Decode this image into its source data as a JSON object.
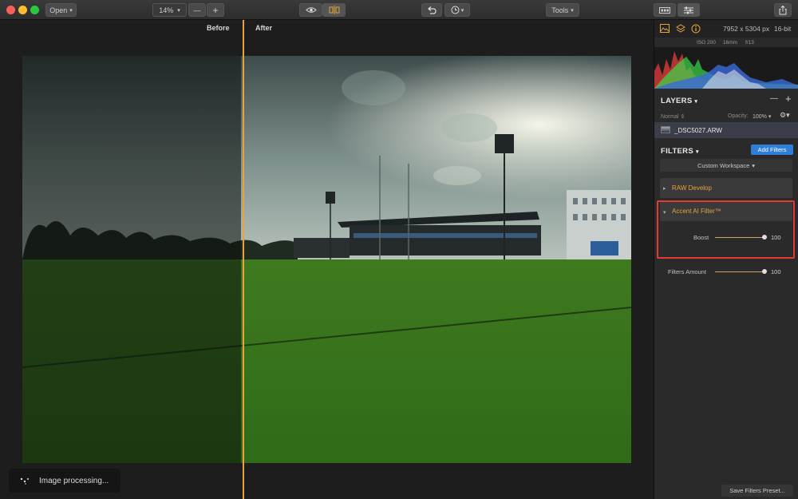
{
  "toolbar": {
    "open_label": "Open",
    "zoom_value": "14%",
    "zoom_minus": "—",
    "zoom_plus": "+",
    "tools_label": "Tools"
  },
  "canvas": {
    "before_label": "Before",
    "after_label": "After",
    "split_position": 0.363
  },
  "toast": {
    "text": "Image processing..."
  },
  "panel": {
    "dimensions": "7952 x 5304 px",
    "bit_depth": "16-bit",
    "exif": {
      "iso": "ISO 200",
      "focal": "16mm",
      "aperture": "f/13"
    },
    "layers": {
      "title": "LAYERS",
      "minus": "—",
      "plus": "+",
      "blend_mode": "Normal",
      "opacity_label": "Opacity:",
      "opacity_value": "100%",
      "layer_name": "_DSC5027.ARW"
    },
    "filters": {
      "title": "FILTERS",
      "add_button": "Add Filters",
      "workspace": "Custom Workspace",
      "raw_develop": "RAW Develop",
      "accent": "Accent AI Filter™",
      "boost_label": "Boost",
      "boost_value": "100",
      "amount_label": "Filters Amount",
      "amount_value": "100"
    },
    "save_preset": "Save Filters Preset..."
  },
  "colors": {
    "accent_orange": "#e8a33b",
    "highlight_red": "#e03c32",
    "button_blue": "#2f7ed8"
  }
}
